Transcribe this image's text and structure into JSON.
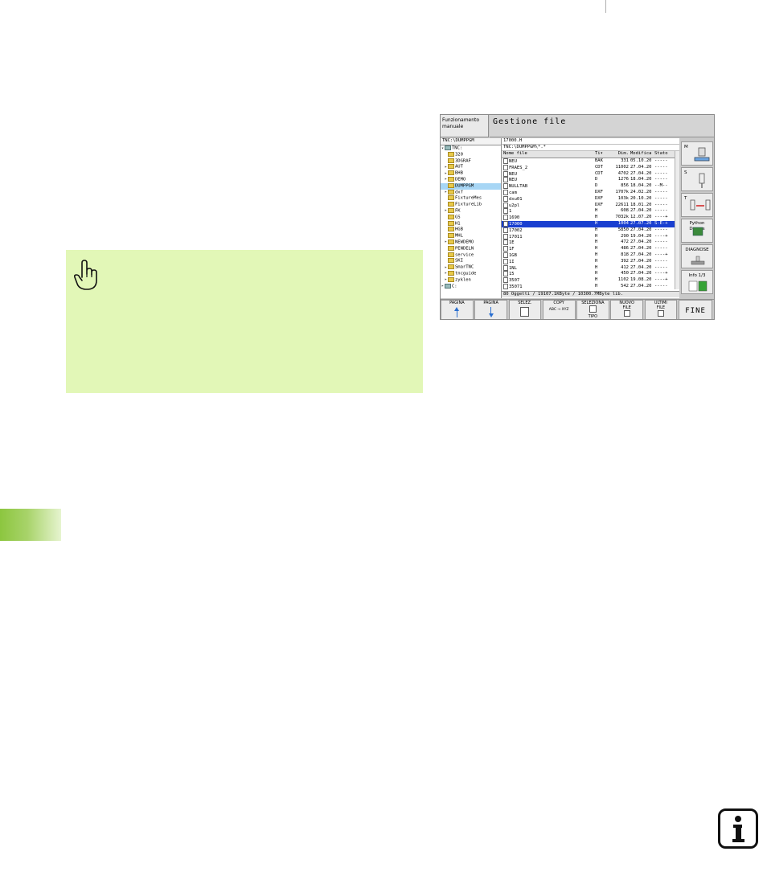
{
  "screen": {
    "mode_label": "Funzionamento manuale",
    "title": "Gestione file",
    "tree_path": "TNC:\\DUMPPGM",
    "tree_items": [
      {
        "label": "TNC:",
        "type": "drive",
        "expander": "▾"
      },
      {
        "label": "320",
        "type": "folder",
        "expander": ""
      },
      {
        "label": "3DGRAF",
        "type": "folder",
        "expander": ""
      },
      {
        "label": "AUT",
        "type": "folder",
        "expander": "▸"
      },
      {
        "label": "BHB",
        "type": "folder",
        "expander": "▸"
      },
      {
        "label": "DEMO",
        "type": "folder",
        "expander": "▸"
      },
      {
        "label": "DUMPPGM",
        "type": "folder",
        "expander": "",
        "selected": true
      },
      {
        "label": "dxf",
        "type": "folder",
        "expander": "▸"
      },
      {
        "label": "FixtureMes",
        "type": "folder",
        "expander": ""
      },
      {
        "label": "FixtureLib",
        "type": "folder",
        "expander": ""
      },
      {
        "label": "FK",
        "type": "folder",
        "expander": "▸"
      },
      {
        "label": "GS",
        "type": "folder",
        "expander": ""
      },
      {
        "label": "H1",
        "type": "folder",
        "expander": ""
      },
      {
        "label": "HGB",
        "type": "folder",
        "expander": ""
      },
      {
        "label": "MHL",
        "type": "folder",
        "expander": ""
      },
      {
        "label": "NEWDEMO",
        "type": "folder",
        "expander": "▸"
      },
      {
        "label": "PENDELN",
        "type": "folder",
        "expander": ""
      },
      {
        "label": "service",
        "type": "folder",
        "expander": ""
      },
      {
        "label": "SKI",
        "type": "folder",
        "expander": ""
      },
      {
        "label": "SmarTNC",
        "type": "folder",
        "expander": "▸"
      },
      {
        "label": "tncguide",
        "type": "folder",
        "expander": "▸"
      },
      {
        "label": "zyklen",
        "type": "folder",
        "expander": "▸"
      },
      {
        "label": "C:",
        "type": "drive",
        "expander": "▸"
      }
    ],
    "selected_file": "17000.H",
    "file_path": "TNC:\\DUMPPGM\\*.*",
    "columns": [
      "Nome file",
      "Ti▾",
      "Dim.",
      "Modifica",
      "Stato"
    ],
    "files": [
      [
        "NEU",
        "BAK",
        "331",
        "05.10.20",
        "-----"
      ],
      [
        "FRAES_2",
        "CDT",
        "11002",
        "27.04.20",
        "-----"
      ],
      [
        "NEU",
        "CDT",
        "4702",
        "27.04.20",
        "-----"
      ],
      [
        "NEU",
        "D",
        "1276",
        "18.04.20",
        "-----"
      ],
      [
        "NULLTAB",
        "D",
        "856",
        "18.04.20",
        "--M--"
      ],
      [
        "cam",
        "DXF",
        "1707k",
        "24.02.20",
        "-----"
      ],
      [
        "dxu01",
        "DXF",
        "103k",
        "20.10.20",
        "-----"
      ],
      [
        "u2pl",
        "DXF",
        "22611",
        "18.01.20",
        "-----"
      ],
      [
        "1",
        "H",
        "608",
        "27.04.20",
        "-----"
      ],
      [
        "1690",
        "H",
        "7032k",
        "12.07.20",
        "----+"
      ],
      [
        "17000",
        "H",
        "1004",
        "27.07.20",
        "S-E-+"
      ],
      [
        "17002",
        "H",
        "5850",
        "27.04.20",
        "-----"
      ],
      [
        "17011",
        "H",
        "290",
        "19.04.20",
        "----+"
      ],
      [
        "1E",
        "H",
        "472",
        "27.04.20",
        "-----"
      ],
      [
        "1F",
        "H",
        "486",
        "27.04.20",
        "-----"
      ],
      [
        "1GB",
        "H",
        "818",
        "27.04.20",
        "----+"
      ],
      [
        "1I",
        "H",
        "392",
        "27.04.20",
        "-----"
      ],
      [
        "1NL",
        "H",
        "412",
        "27.04.20",
        "-----"
      ],
      [
        "15",
        "H",
        "450",
        "27.04.20",
        "----+"
      ],
      [
        "3507",
        "H",
        "1102",
        "19.08.20",
        "----+"
      ],
      [
        "35071",
        "H",
        "542",
        "27.04.20",
        "-----"
      ]
    ],
    "selected_row_index": 10,
    "status_line": "80 Oggetti / 19107.1KByte / 10300.7MByte lib.",
    "side_keys": [
      {
        "label": "M",
        "icon": "machine-icon"
      },
      {
        "label": "S",
        "icon": "spindle-icon"
      },
      {
        "label": "T",
        "icon": "tool-change-icon"
      },
      {
        "label": "Python Demos",
        "icon": "python-icon"
      },
      {
        "label": "DIAGNOSE",
        "icon": "diagnose-icon"
      },
      {
        "label": "Info 1/3",
        "icon": "info-panel-icon"
      }
    ],
    "soft_keys": [
      {
        "line1": "PAGINA",
        "line2": "",
        "icon": "arrow-up-icon"
      },
      {
        "line1": "PAGINA",
        "line2": "",
        "icon": "arrow-down-icon"
      },
      {
        "line1": "SELEZ.",
        "line2": "",
        "icon": "document-icon"
      },
      {
        "line1": "COPY",
        "line2": "ABC → XYZ",
        "icon": "copy-icon"
      },
      {
        "line1": "SELEZIONA",
        "line2": "TIPO",
        "icon": "file-type-icon"
      },
      {
        "line1": "NUOVO",
        "line2": "FILE",
        "icon": "new-file-icon"
      },
      {
        "line1": "ULTIMI",
        "line2": "FILE",
        "icon": "recent-files-icon"
      }
    ],
    "end_key": "FINE"
  },
  "colors": {
    "note_background": "#e2f7b7",
    "chapter_tab": "#8cc63f",
    "selection": "#1a3fd0"
  }
}
